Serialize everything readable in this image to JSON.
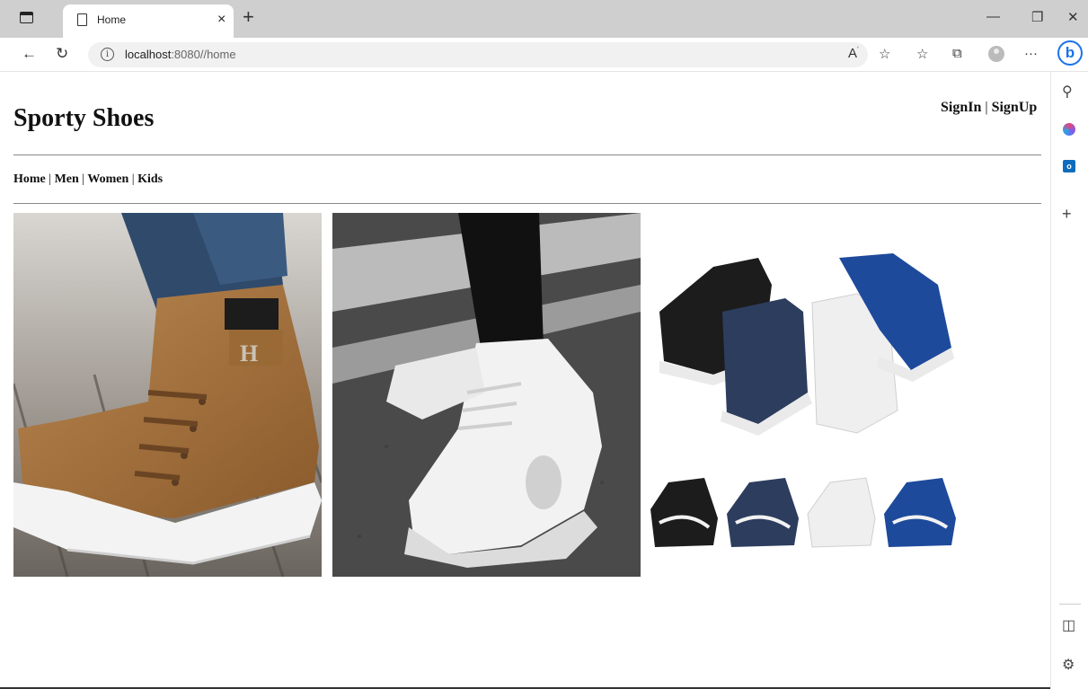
{
  "browser": {
    "tab_title": "Home",
    "url_host": "localhost",
    "url_rest": ":8080//home"
  },
  "site": {
    "title": "Sporty Shoes",
    "signin_label": "SignIn",
    "signup_label": "SignUp",
    "separator": "|",
    "nav": [
      "Home",
      "Men",
      "Women",
      "Kids"
    ]
  }
}
